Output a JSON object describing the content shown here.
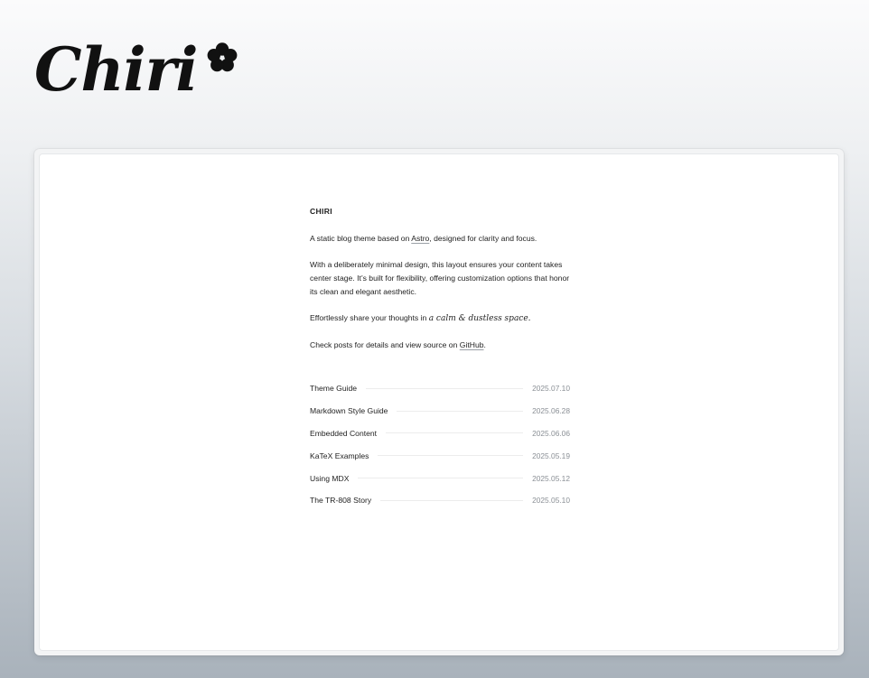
{
  "logo": {
    "word": "Chiri",
    "icon": "flower-icon"
  },
  "site": {
    "title": "CHIRI"
  },
  "intro": {
    "p1_before": "A static blog theme based on ",
    "p1_link": "Astro",
    "p1_after": ", designed for clarity and focus.",
    "p2": "With a deliberately minimal design, this layout ensures your content takes center stage. It’s built for flexibility, offering customization options that honor its clean and elegant aesthetic.",
    "p3_before": "Effortlessly share your thoughts in ",
    "p3_fancy": "a calm & dustless space.",
    "p4_before": "Check posts for details and view source on ",
    "p4_link": "GitHub",
    "p4_after": "."
  },
  "posts": [
    {
      "title": "Theme Guide",
      "date": "2025.07.10"
    },
    {
      "title": "Markdown Style Guide",
      "date": "2025.06.28"
    },
    {
      "title": "Embedded Content",
      "date": "2025.06.06"
    },
    {
      "title": "KaTeX Examples",
      "date": "2025.05.19"
    },
    {
      "title": "Using MDX",
      "date": "2025.05.12"
    },
    {
      "title": "The TR-808 Story",
      "date": "2025.05.10"
    }
  ],
  "colors": {
    "text": "#1f1f1f",
    "date": "#8a8f95",
    "rule": "#ececec",
    "page": "#ffffff"
  }
}
